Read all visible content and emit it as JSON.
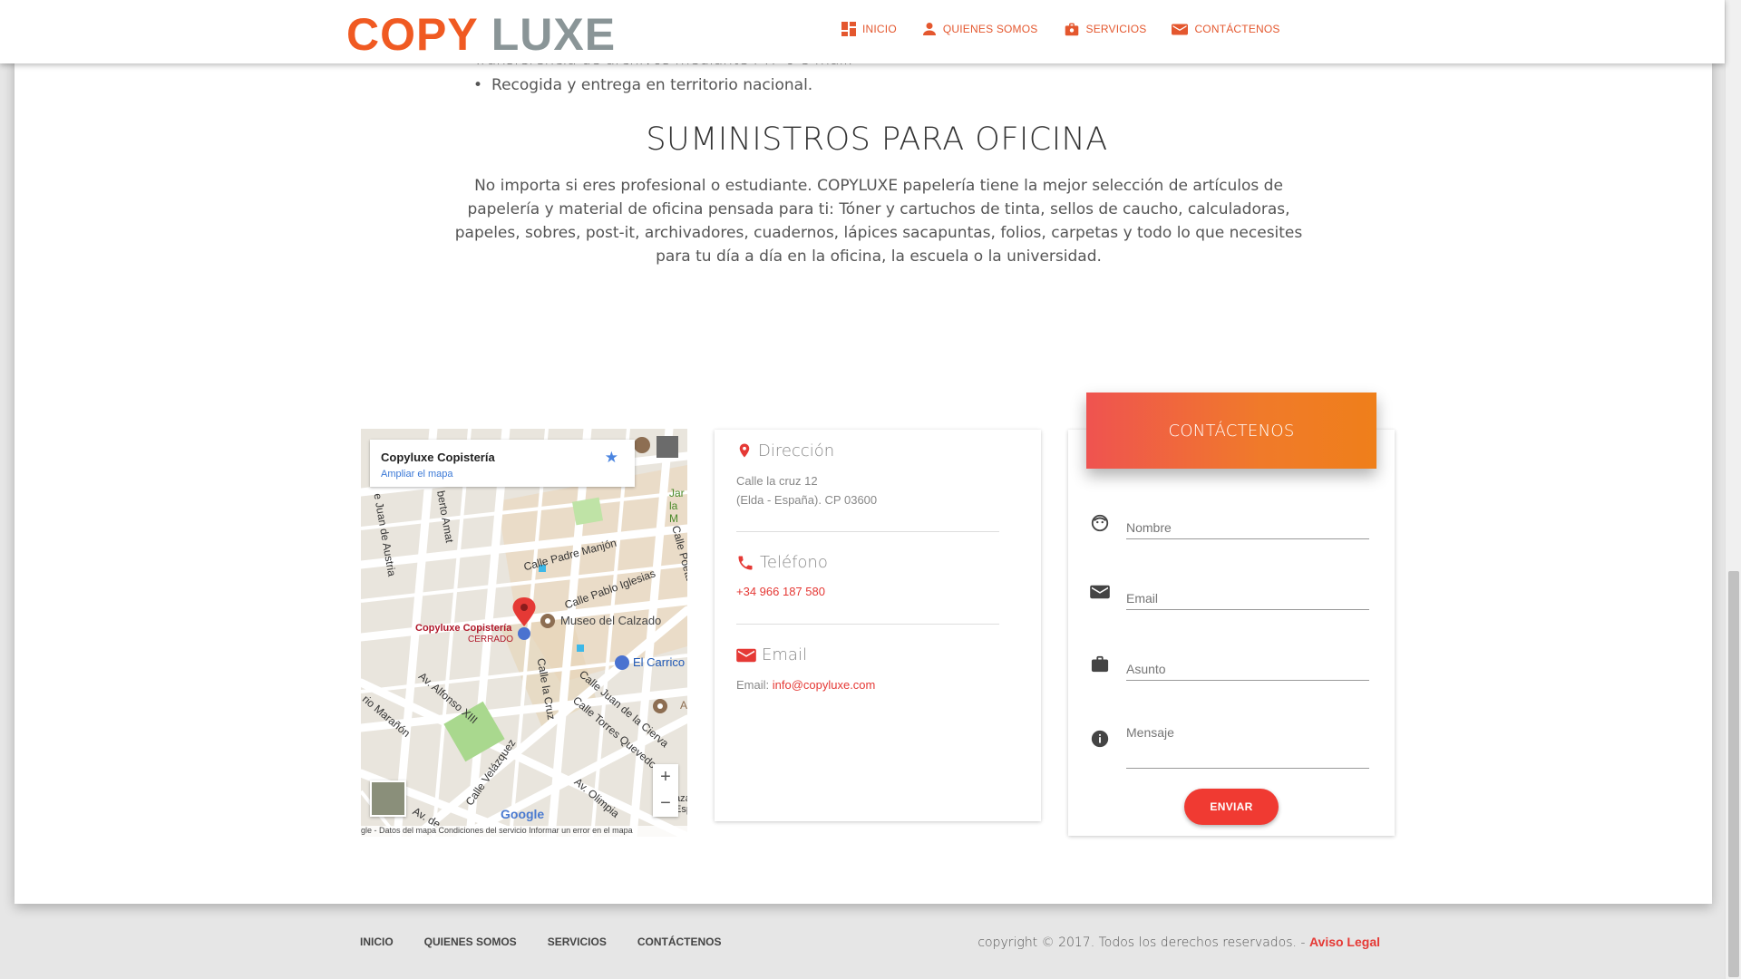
{
  "header": {
    "logo_part1": "COPY",
    "logo_part2": "LUXE",
    "nav": [
      {
        "label": "INICIO",
        "icon": "grid-icon"
      },
      {
        "label": "QUIENES SOMOS",
        "icon": "person-icon"
      },
      {
        "label": "SERVICIOS",
        "icon": "briefcase-icon"
      },
      {
        "label": "CONTÁCTENOS",
        "icon": "mail-icon"
      }
    ]
  },
  "services": {
    "cut_bullet": "Transferencia de archivos mediante FTP o e-mail.",
    "bullet": "Recogida y entrega en territorio nacional.",
    "title": "SUMINISTROS PARA OFICINA",
    "text": "No importa si eres profesional o estudiante. COPYLUXE papelería tiene la mejor selección de artículos de papelería y material de oficina pensada para ti: Tóner y cartuchos de tinta, sellos de caucho, calculadoras, papeles, sobres, post-it, archivadores, cuadernos, lápices sacapuntas, folios, carpetas y todo lo que necesites para tu día a día en la oficina, la escuela o la universidad."
  },
  "map": {
    "place_name": "Copyluxe Copistería",
    "enlarge": "Ampliar el mapa",
    "pin_name": "Copyluxe Copistería",
    "pin_status": "CERRADO",
    "labels": {
      "museum": "Museo del Calzado",
      "carrico": "El Carrico",
      "padre_manjon": "Calle Padre Manjón",
      "pablo_iglesias": "Calle Pablo Iglesias",
      "la_cruz": "Calle la Cruz",
      "juan_cierva": "Calle Juan de la Cierva",
      "torres_quevedo": "Calle Torres Quevedo",
      "alfonso": "Av. Alfonso XIII",
      "velazquez": "Calle Velázquez",
      "maranon": "rio Marañón",
      "austria": "e Juan de Austria",
      "amat": "berto Amat",
      "olimpia": "Av. Olimpia",
      "poeta": "Calle Poeta",
      "jardin": "Jar la M",
      "av_de": "Av. de",
      "a_cut": "A",
      "plaza_cut": "aza Españ"
    },
    "zoom_in": "+",
    "zoom_out": "−",
    "google": "Google",
    "footer": "gle - Datos del mapa   Condiciones del servicio   Informar un error en el mapa"
  },
  "info": {
    "address_title": "Dirección",
    "address_line1": "Calle la cruz 12",
    "address_line2": "(Elda - España). CP 03600",
    "phone_title": "Teléfono",
    "phone": "+34 966 187 580",
    "email_title": "Email",
    "email_label": "Email: ",
    "email": "info@copyluxe.com"
  },
  "form": {
    "title": "CONTÁCTENOS",
    "name_placeholder": "Nombre",
    "email_placeholder": "Email",
    "subject_placeholder": "Asunto",
    "message_placeholder": "Mensaje",
    "send": "ENVIAR"
  },
  "footer": {
    "nav": [
      "INICIO",
      "QUIENES SOMOS",
      "SERVICIOS",
      "CONTÁCTENOS"
    ],
    "copyright": "copyright © 2017. Todos los derechos reservados. - ",
    "legal": "Aviso Legal"
  },
  "colors": {
    "accent": "#e4572e",
    "logo_orange": "#f05a22",
    "logo_grey": "#8a9597",
    "red": "#e53935"
  }
}
